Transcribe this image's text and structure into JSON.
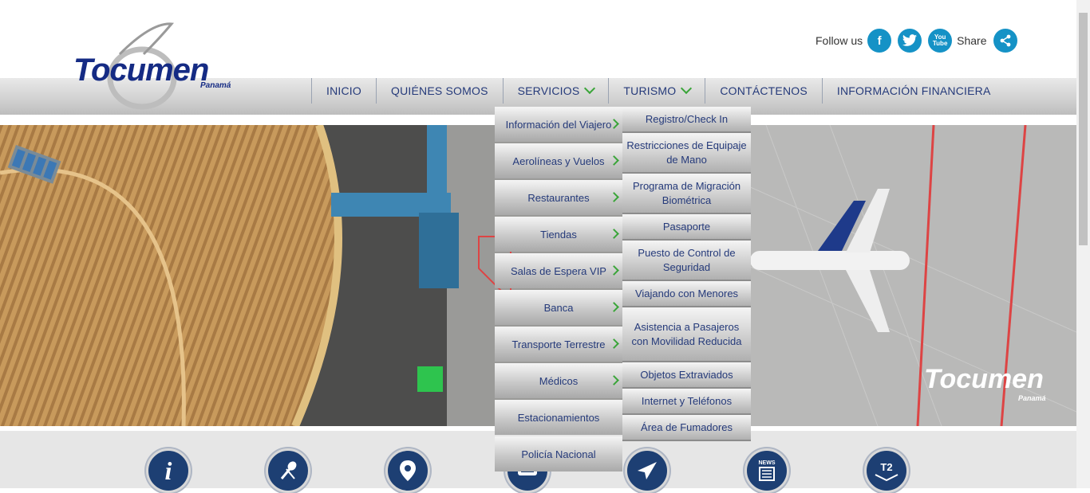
{
  "header": {
    "logo": {
      "name": "Tocumen",
      "sub": "Panamá"
    },
    "social": {
      "follow_label": "Follow us",
      "share_label": "Share",
      "facebook_glyph": "f",
      "twitter_glyph": "t",
      "youtube_glyph": "You Tube",
      "icons": [
        "facebook-icon",
        "twitter-icon",
        "youtube-icon",
        "share-icon"
      ]
    }
  },
  "nav": {
    "items": [
      {
        "label": "INICIO"
      },
      {
        "label": "QUIÉNES SOMOS"
      },
      {
        "label": "SERVICIOS",
        "has_dropdown": true
      },
      {
        "label": "TURISMO",
        "has_dropdown": true
      },
      {
        "label": "CONTÁCTENOS"
      },
      {
        "label": "INFORMACIÓN FINANCIERA"
      }
    ]
  },
  "servicios_menu": [
    "Información del Viajero",
    "Aerolíneas y Vuelos",
    "Restaurantes",
    "Tiendas",
    "Salas de Espera VIP",
    "Banca",
    "Transporte Terrestre",
    "Médicos",
    "Estacionamientos",
    "Policía Nacional"
  ],
  "viajero_menu": [
    "Registro/Check In",
    "Restricciones de Equipaje de Mano",
    "Programa de Migración Biométrica",
    "Pasaporte",
    "Puesto de Control de Seguridad",
    "Viajando con Menores",
    "Asistencia a Pasajeros con Movilidad Reducida",
    "Objetos Extraviados",
    "Internet y Teléfonos",
    "Área de Fumadores"
  ],
  "hero": {
    "watermark": "Tocumen",
    "watermark_sub": "Panamá"
  },
  "quick_icons": {
    "info": "i",
    "news": "NEWS",
    "t2": "T2",
    "names": [
      "info-icon",
      "food-icon",
      "location-icon",
      "parking-icon",
      "airplane-icon",
      "news-icon",
      "t2-terminal-icon"
    ]
  },
  "colors": {
    "brand_blue": "#152b84",
    "accent_green": "#3aa539",
    "social_blue": "#1592c6"
  }
}
